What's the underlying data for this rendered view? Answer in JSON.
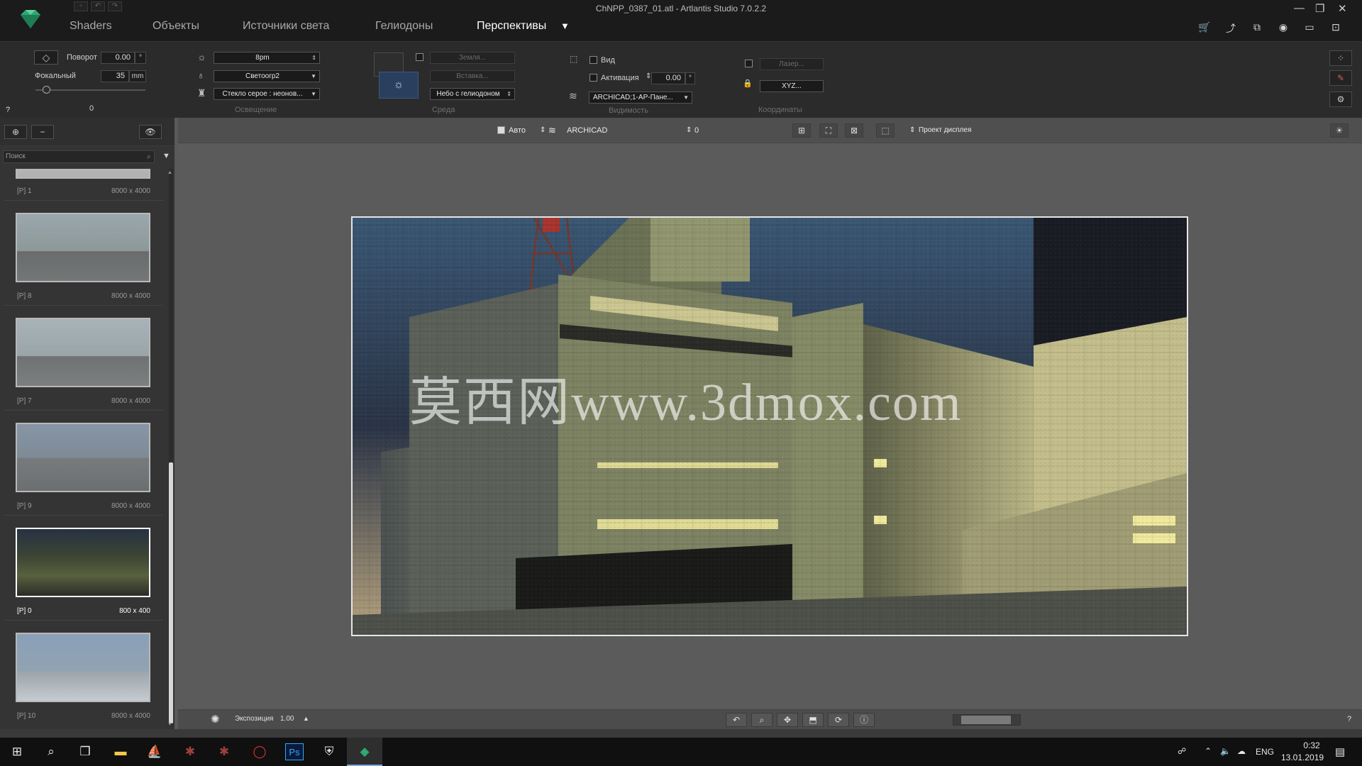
{
  "window": {
    "title": "ChNPP_0387_01.atl - Artlantis Studio 7.0.2.2",
    "controls": [
      "—",
      "❐",
      "✕"
    ]
  },
  "menu": {
    "tabs": [
      {
        "label": "Shaders"
      },
      {
        "label": "Объекты"
      },
      {
        "label": "Источники света"
      },
      {
        "label": "Гелиодоны"
      },
      {
        "label": "Перспективы"
      }
    ],
    "active_tab_arrow": "▼"
  },
  "toolbar_icons": [
    "cart-icon",
    "export-icon",
    "windows-icon",
    "camera-icon",
    "render-frame-icon",
    "console-icon"
  ],
  "params": {
    "rotation_label": "Поворот",
    "rotation_value": "0.00",
    "rotation_unit": "°",
    "focal_label": "Фокальный",
    "focal_value": "35",
    "focal_unit": "mm",
    "help": "?",
    "zero_value": "0",
    "lighting": {
      "time": "8pm",
      "light_set": "Светоогр2",
      "glass": "Стекло серое : неонов...",
      "section": "Освещение"
    },
    "environment": {
      "ground": "Земля...",
      "insert": "Вставка...",
      "sky": "Небо с гелиодоном",
      "section": "Среда"
    },
    "visibility": {
      "view_label": "Вид",
      "activation_label": "Активация",
      "activation_value": "0.00",
      "activation_unit": "°",
      "layer": "ARCHICAD;1-АР-Пане...",
      "section": "Видимость"
    },
    "coordinates": {
      "laser": "Лазер...",
      "xyz": "XYZ...",
      "section": "Координаты"
    }
  },
  "sidebar": {
    "search_placeholder": "Поиск",
    "thumbnails": [
      {
        "label": "[P] 1",
        "size": "8000 x 4000"
      },
      {
        "label": "[P] 8",
        "size": "8000 x 4000"
      },
      {
        "label": "[P] 7",
        "size": "8000 x 4000"
      },
      {
        "label": "[P] 9",
        "size": "8000 x 4000"
      },
      {
        "label": "[P] 0",
        "size": "800 x 400"
      },
      {
        "label": "[P] 10",
        "size": "8000 x 4000"
      }
    ]
  },
  "viewport": {
    "auto_label": "Авто",
    "camera_label": "ARCHICAD",
    "number": "0",
    "display_project": "Проект дисплея",
    "watermark": "莫西网www.3dmox.com",
    "exposure_label": "Экспозиция",
    "exposure_value": "1.00",
    "help": "?"
  },
  "taskbar": {
    "lang": "ENG",
    "time": "0:32",
    "date": "13.01.2019",
    "ps_label": "Ps"
  },
  "colors": {
    "accent_green": "#2fa873",
    "sky_tile": "#2a3f5e",
    "taskbar_active": "#7aa6dc"
  }
}
